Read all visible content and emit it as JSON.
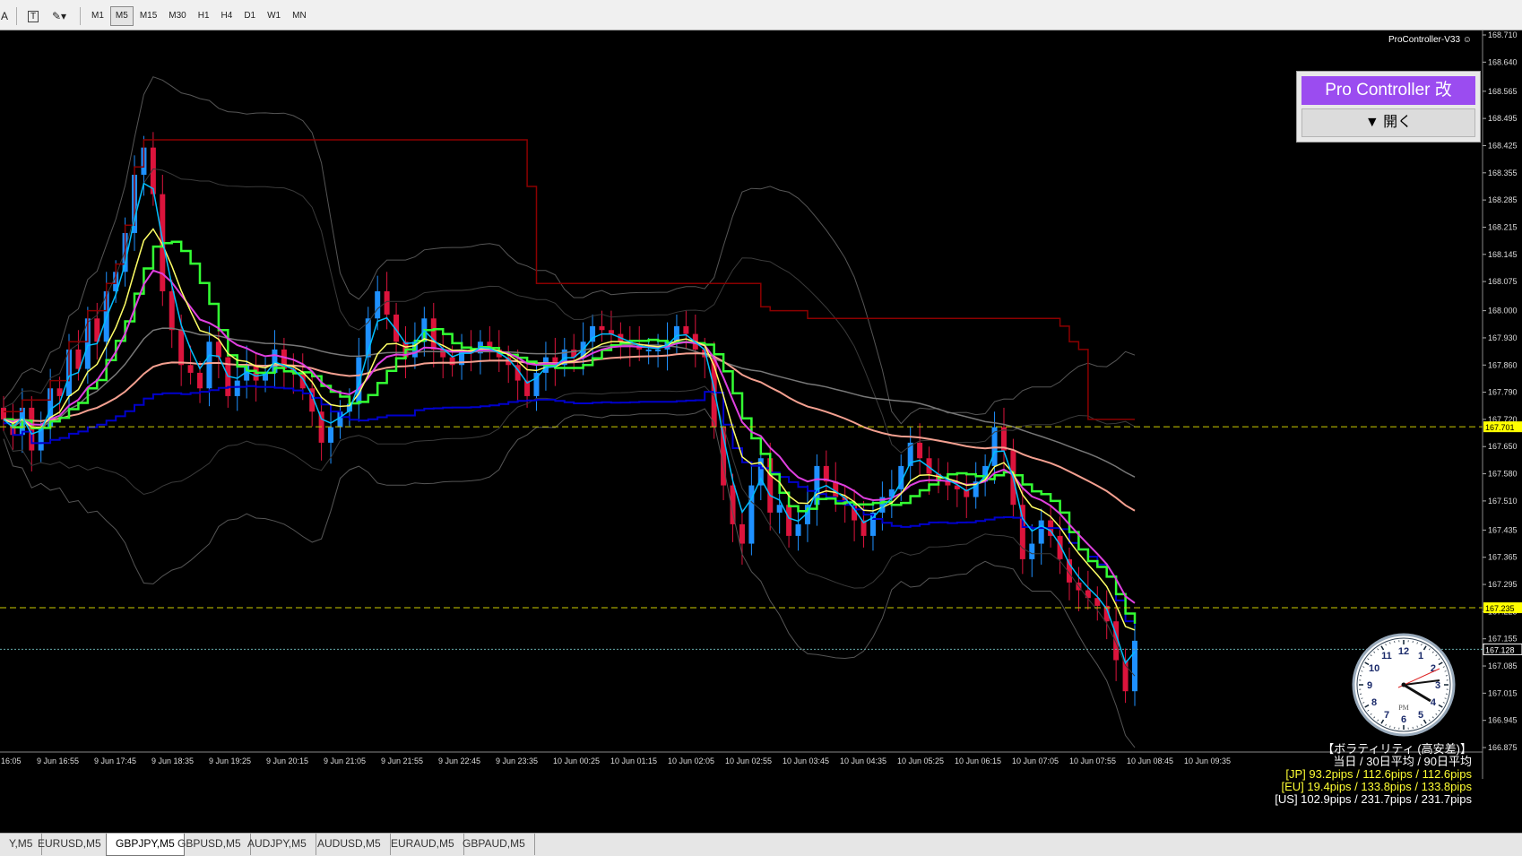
{
  "toolbar": {
    "icons": [
      "text-a-icon",
      "text-t-icon",
      "draw-tools-icon"
    ],
    "timeframes": [
      "M1",
      "M5",
      "M15",
      "M30",
      "H1",
      "H4",
      "D1",
      "W1",
      "MN"
    ],
    "active_timeframe": "M5"
  },
  "indicator_label": "ProController-V33 ☺",
  "panel": {
    "title": "Pro Controller 改",
    "open_label": "▼ 開く"
  },
  "volatility": {
    "header": "【ボラティリティ (高安差)】",
    "subheader": "当日 / 30日平均 / 90日平均",
    "jp": "[JP] 93.2pips / 112.6pips / 112.6pips",
    "eu": "[EU] 19.4pips / 133.8pips / 133.8pips",
    "us": "[US] 102.9pips / 231.7pips / 231.7pips"
  },
  "clock": {
    "period": "PM",
    "numbers": [
      "12",
      "1",
      "2",
      "3",
      "4",
      "5",
      "6",
      "7",
      "8",
      "9",
      "10",
      "11"
    ]
  },
  "price_axis": [
    "168.710",
    "168.640",
    "168.565",
    "168.495",
    "168.425",
    "168.355",
    "168.285",
    "168.215",
    "168.145",
    "168.075",
    "168.000",
    "167.930",
    "167.860",
    "167.790",
    "167.720",
    "167.650",
    "167.580",
    "167.510",
    "167.435",
    "167.365",
    "167.295",
    "167.225",
    "167.155",
    "167.085",
    "167.015",
    "166.945",
    "166.875"
  ],
  "price_markers": [
    {
      "label": "167.701",
      "color": "#ffff00"
    },
    {
      "label": "167.235",
      "color": "#ffff00"
    },
    {
      "label": "167.128",
      "color": "#ffffff"
    }
  ],
  "time_axis": [
    "16:05",
    "9 Jun 16:55",
    "9 Jun 17:45",
    "9 Jun 18:35",
    "9 Jun 19:25",
    "9 Jun 20:15",
    "9 Jun 21:05",
    "9 Jun 21:55",
    "9 Jun 22:45",
    "9 Jun 23:35",
    "10 Jun 00:25",
    "10 Jun 01:15",
    "10 Jun 02:05",
    "10 Jun 02:55",
    "10 Jun 03:45",
    "10 Jun 04:35",
    "10 Jun 05:25",
    "10 Jun 06:15",
    "10 Jun 07:05",
    "10 Jun 07:55",
    "10 Jun 08:45",
    "10 Jun 09:35"
  ],
  "tabs": [
    "Y,M5",
    "EURUSD,M5",
    "GBPJPY,M5",
    "GBPUSD,M5",
    "AUDJPY,M5",
    "AUDUSD,M5",
    "EURAUD,M5",
    "GBPAUD,M5"
  ],
  "active_tab": "GBPJPY,M5",
  "colors": {
    "background": "#000000",
    "bull": "#1e90ff",
    "bear": "#dc143c",
    "ma_fast": "#00bfff",
    "ma_yellow": "#ffff66",
    "ma_magenta": "#e040e0",
    "ma_green": "#33ff33",
    "ma_salmon": "#f4a090",
    "channel_blue": "#0000cc",
    "channel_red": "#8b0000"
  },
  "candles": [
    167.72,
    167.68,
    167.75,
    167.64,
    167.7,
    167.8,
    167.78,
    167.9,
    167.85,
    167.98,
    167.92,
    168.05,
    168.1,
    168.2,
    168.35,
    168.42,
    168.3,
    168.05,
    167.95,
    167.86,
    167.84,
    167.8,
    167.92,
    167.88,
    167.78,
    167.82,
    167.86,
    167.82,
    167.84,
    167.9,
    167.85,
    167.84,
    167.8,
    167.74,
    167.66,
    167.7,
    167.74,
    167.76,
    167.88,
    167.98,
    168.05,
    167.99,
    167.92,
    167.88,
    167.92,
    167.98,
    167.9,
    167.88,
    167.86,
    167.9,
    167.89,
    167.92,
    167.9,
    167.88,
    167.86,
    167.82,
    167.78,
    167.84,
    167.88,
    167.86,
    167.9,
    167.88,
    167.92,
    167.96,
    167.95,
    167.94,
    167.92,
    167.91,
    167.9,
    167.9,
    167.9,
    167.92,
    167.96,
    167.94,
    167.9,
    167.88,
    167.7,
    167.55,
    167.45,
    167.4,
    167.55,
    167.62,
    167.48,
    167.5,
    167.42,
    167.45,
    167.5,
    167.6,
    167.56,
    167.52,
    167.5,
    167.46,
    167.42,
    167.48,
    167.52,
    167.54,
    167.6,
    167.66,
    167.62,
    167.58,
    167.56,
    167.55,
    167.54,
    167.52,
    167.56,
    167.6,
    167.7,
    167.64,
    167.5,
    167.36,
    167.4,
    167.46,
    167.42,
    167.36,
    167.3,
    167.28,
    167.26,
    167.24,
    167.2,
    167.1,
    167.02,
    167.15
  ]
}
